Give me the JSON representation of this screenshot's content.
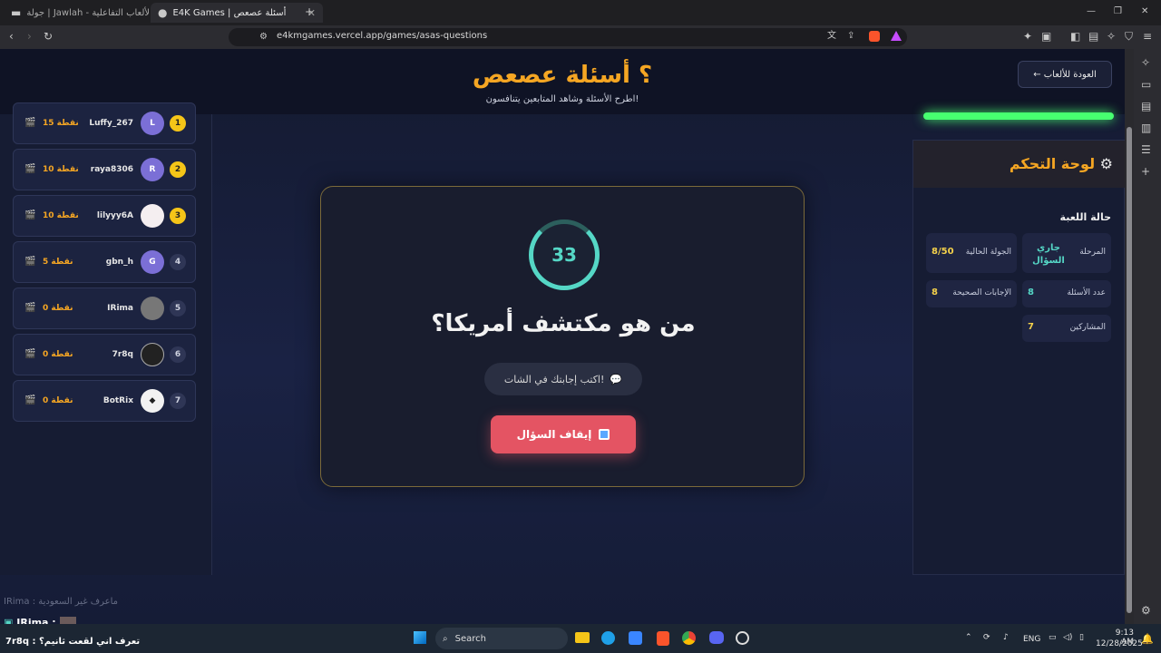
{
  "browser": {
    "tabs": [
      {
        "label": "جولة | Jawlah - منصة الألعاب التفاعلية",
        "active": false
      },
      {
        "label": "E4K Games | أسئلة عصعص",
        "active": true
      }
    ],
    "new_tab": "+",
    "url": "e4kmgames.vercel.app/games/asas-questions"
  },
  "header": {
    "title": "؟ أسئلة عصعص",
    "subtitle": "اطرح الأسئلة وشاهد المتابعين يتنافسون!",
    "back_button": "← العودة للألعاب"
  },
  "leaderboard": [
    {
      "rank": "1",
      "avatar": "L",
      "name": "Luffy_267",
      "points": "15 نقطة"
    },
    {
      "rank": "2",
      "avatar": "R",
      "name": "raya8306",
      "points": "10 نقطة"
    },
    {
      "rank": "3",
      "avatar": "",
      "name": "lilyyy6A",
      "points": "10 نقطة"
    },
    {
      "rank": "4",
      "avatar": "G",
      "name": "gbn_h",
      "points": "5 نقطة"
    },
    {
      "rank": "5",
      "avatar": "",
      "name": "IRima",
      "points": "0 نقطة"
    },
    {
      "rank": "6",
      "avatar": "",
      "name": "7r8q",
      "points": "0 نقطة"
    },
    {
      "rank": "7",
      "avatar": "",
      "name": "BotRix",
      "points": "0 نقطة"
    }
  ],
  "game": {
    "timer": "33",
    "question": "من هو مكتشف أمريكا؟",
    "hint": "اكتب إجابتك في الشات!",
    "stop_button": "إيقاف السؤال"
  },
  "control_panel": {
    "title": "لوحة التحكم",
    "section_title": "حالة اللعبة",
    "stats": {
      "stage_label": "المرحلة",
      "stage_value": "جاري السؤال",
      "round_label": "الجولة الحالية",
      "round_value": "8/50",
      "questions_label": "عدد الأسئلة",
      "questions_value": "8",
      "correct_label": "الإجابات الصحيحة",
      "correct_value": "8",
      "participants_label": "المشاركين",
      "participants_value": "7"
    }
  },
  "chat_overlay": {
    "line1": "IRima : ماعرف غير السعودية",
    "line2_user": "IRima :",
    "line3": "7r8q : تعرف اني لقعت ثانيم؟"
  },
  "taskbar": {
    "search": "Search",
    "lang": "ENG",
    "time": "9:13 AM",
    "date": "12/28/2025"
  }
}
